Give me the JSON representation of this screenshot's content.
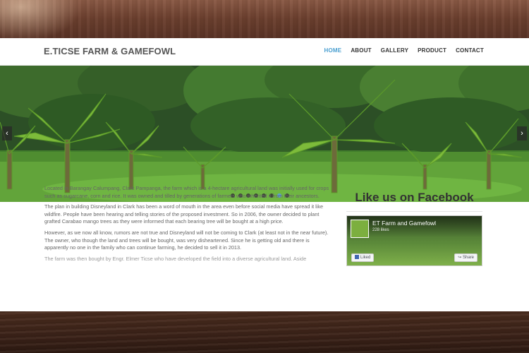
{
  "site": {
    "logo": "E.TICSE FARM & GAMEFOWL",
    "nav": [
      {
        "label": "HOME"
      },
      {
        "label": "ABOUT"
      },
      {
        "label": "GALLERY"
      },
      {
        "label": "PRODUCT"
      },
      {
        "label": "CONTACT"
      }
    ],
    "active_nav": "HOME"
  },
  "slider": {
    "prev_icon": "‹",
    "next_icon": "›",
    "dots_count": 8,
    "active_dot": 7
  },
  "content": {
    "paragraphs": [
      "Located in Barangay Calumpang, Clark Pampanga, the farm which is a 4-hectare agricultural land was initially used for crops such as sugarcane, corn and rice. It was owned and tilled by generations of farmers who inherited it from their ancestors.",
      "The plan in building Disneyland in Clark has been a word of mouth in the area even before social media have spread it like wildfire. People have been hearing and telling stories of the proposed investment. So in 2006, the owner decided to plant grafted Carabao mango trees as they were informed that each bearing tree will be bought at a high price.",
      "However, as we now all know, rumors are not true and Disneyland will not be coming to Clark (at least not in the near future). The owner, who though the land and trees will be bought, was very disheartened. Since he is getting old and there is apparently no one in the family who can continue farming, he decided to sell it in 2013.",
      "The farm was then bought by Engr. Elmer Ticse who have developed the field into a diverse agricultural land. Aside"
    ]
  },
  "sidebar": {
    "title": "Like us on Facebook",
    "fb": {
      "page_name": "ET Farm and Gamefowl",
      "likes": "228 likes",
      "like_label": "Liked",
      "share_label": "Share"
    }
  },
  "colors": {
    "accent": "#4a9fd0",
    "logo_text": "#555555",
    "body_text": "#666666"
  }
}
